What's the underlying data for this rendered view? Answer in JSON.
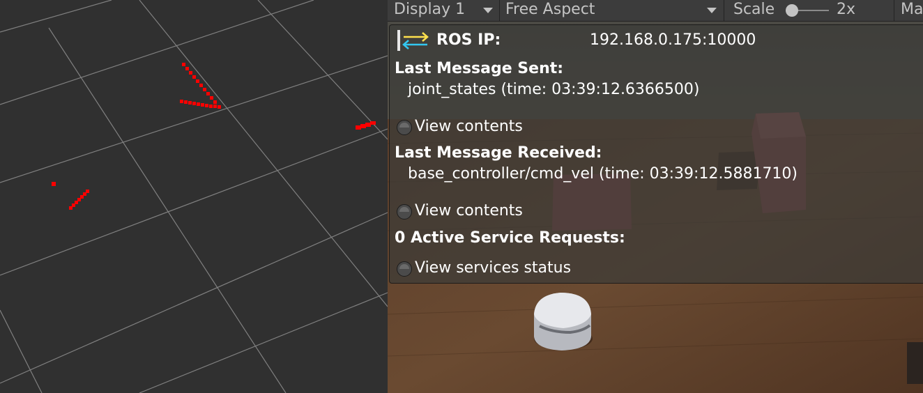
{
  "toolbar": {
    "display": "Display 1",
    "aspect": "Free Aspect",
    "scale_label": "Scale",
    "scale_value": "2x",
    "scale_level": 0.1,
    "maximize": "Ma"
  },
  "hud": {
    "ros_ip_label": "ROS IP:",
    "ros_ip_value": "192.168.0.175:10000",
    "last_sent_label": "Last Message Sent:",
    "last_sent_value": "joint_states (time: 03:39:12.6366500)",
    "view_contents_1": "View contents",
    "last_received_label": "Last Message Received:",
    "last_received_value": "base_controller/cmd_vel (time: 03:39:12.5881710)",
    "view_contents_2": "View contents",
    "services_label": "0 Active Service Requests:",
    "view_services": "View services status"
  },
  "colors": {
    "laser_points": "#ff0000",
    "rviz_background": "#303030",
    "grid": "#9a9a9a",
    "table_wood": "#5a3c28",
    "box": "#8a4a4a"
  },
  "icons": {
    "ros_connection": "bidirectional-arrows-icon"
  }
}
